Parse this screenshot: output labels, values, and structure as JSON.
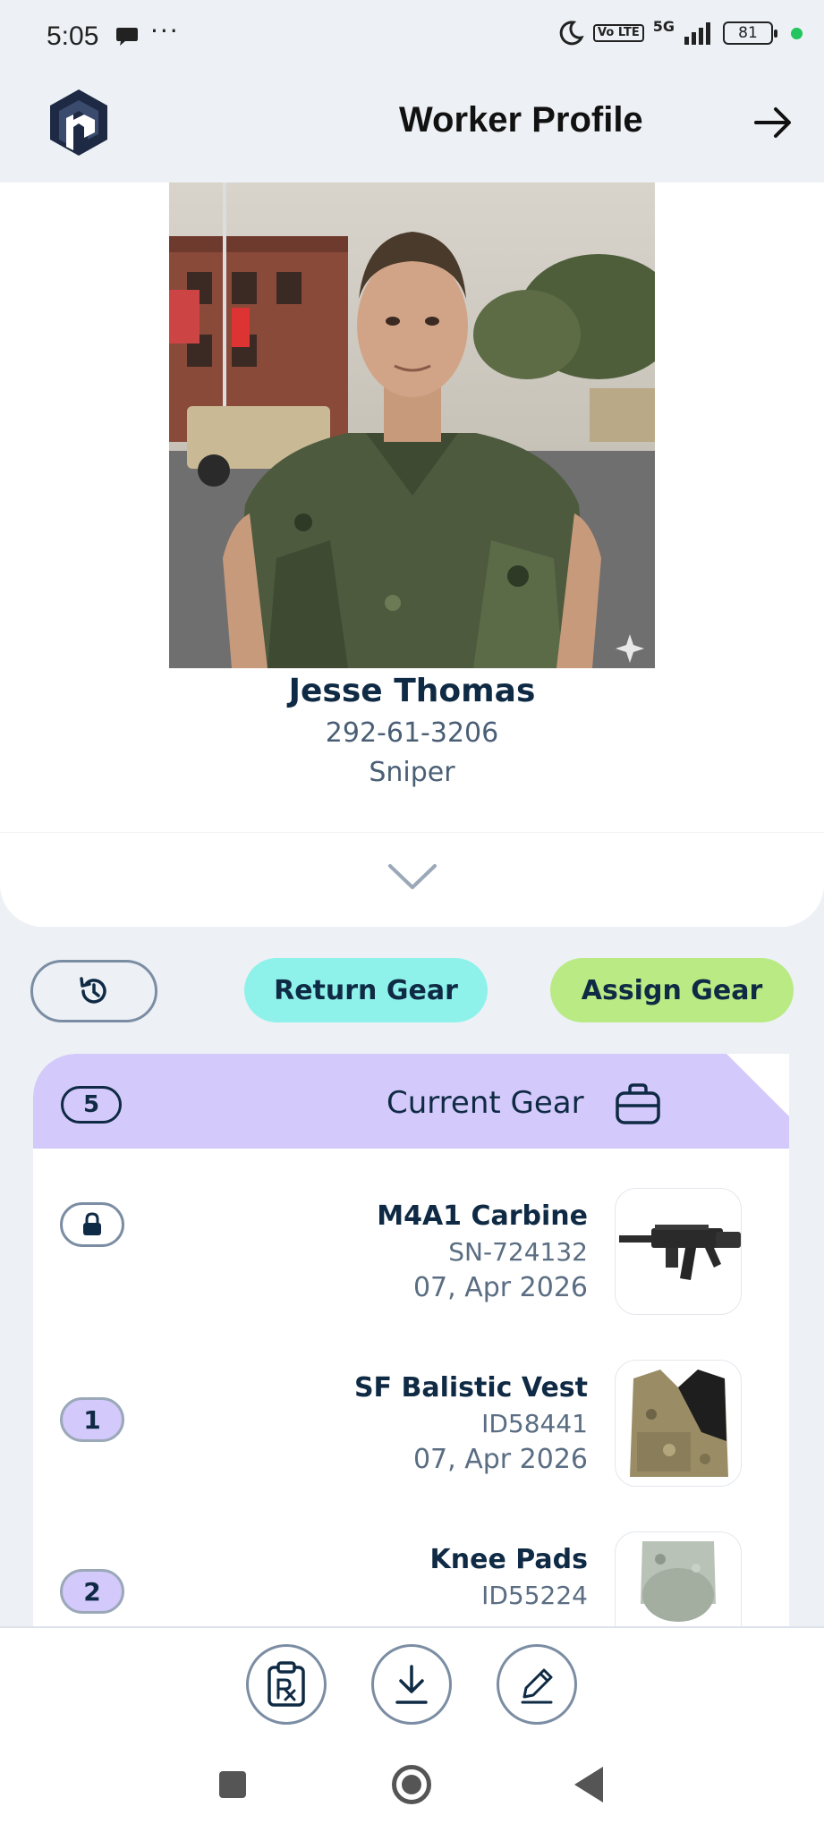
{
  "status_bar": {
    "time": "5:05",
    "more": "···",
    "volte": "Vo LTE",
    "network": "5G",
    "battery": "81"
  },
  "header": {
    "title": "Worker Profile"
  },
  "profile": {
    "name": "Jesse Thomas",
    "id_number": "292-61-3206",
    "role": "Sniper"
  },
  "actions": {
    "return_label": "Return Gear",
    "assign_label": "Assign Gear"
  },
  "gear": {
    "count": "5",
    "title": "Current Gear",
    "items": [
      {
        "name": "M4A1 Carbine",
        "id": "SN-724132",
        "date": "07, Apr 2026",
        "badge": ""
      },
      {
        "name": "SF Balistic Vest",
        "id": "ID58441",
        "date": "07, Apr 2026",
        "badge": "1"
      },
      {
        "name": "Knee Pads",
        "id": "ID55224",
        "date": "",
        "badge": "2"
      }
    ]
  },
  "colors": {
    "accent_return": "#8ef2ea",
    "accent_assign": "#b9ea84",
    "gear_header": "#d3c9fb",
    "text_primary": "#0f2a44"
  }
}
